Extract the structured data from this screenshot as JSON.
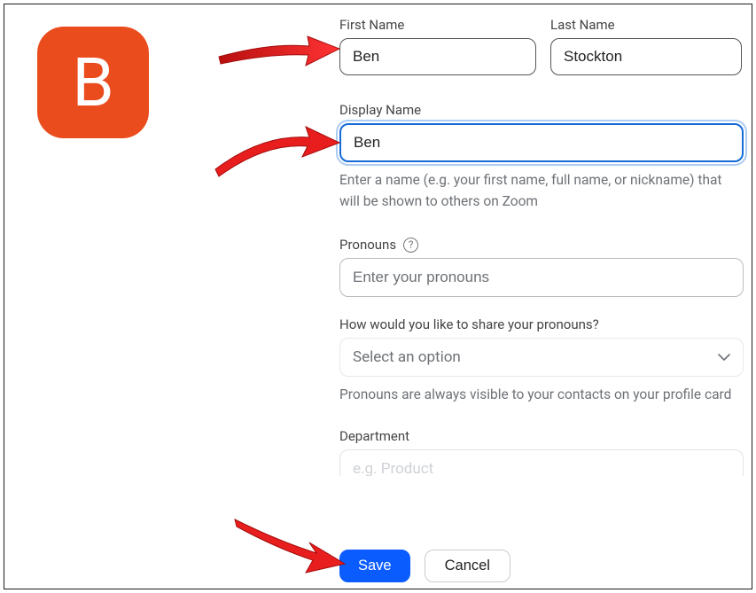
{
  "avatar": {
    "letter": "B",
    "bg": "#ea4c1d"
  },
  "fields": {
    "firstName": {
      "label": "First Name",
      "value": "Ben"
    },
    "lastName": {
      "label": "Last Name",
      "value": "Stockton"
    },
    "displayName": {
      "label": "Display Name",
      "value": "Ben",
      "helper": "Enter a name (e.g. your first name, full name, or nickname) that will be shown to others on Zoom"
    },
    "pronouns": {
      "label": "Pronouns",
      "placeholder": "Enter your pronouns"
    },
    "sharePronouns": {
      "label": "How would you like to share your pronouns?",
      "placeholder": "Select an option",
      "helper": "Pronouns are always visible to your contacts on your profile card"
    },
    "department": {
      "label": "Department",
      "placeholder": "e.g. Product"
    }
  },
  "buttons": {
    "save": "Save",
    "cancel": "Cancel"
  }
}
